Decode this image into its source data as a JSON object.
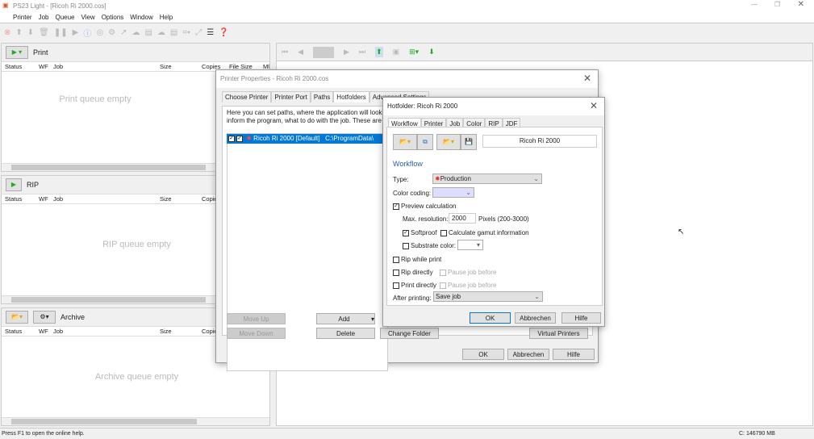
{
  "app": {
    "title": "PS23 Light - [Ricoh Ri 2000.cos]"
  },
  "menu": [
    "Printer",
    "Job",
    "Queue",
    "View",
    "Options",
    "Window",
    "Help"
  ],
  "print_panel": {
    "title": "Print",
    "empty": "Print queue empty"
  },
  "rip_panel": {
    "title": "RIP",
    "empty": "RIP queue empty"
  },
  "archive_panel": {
    "title": "Archive",
    "empty": "Archive queue empty"
  },
  "columns": [
    "Status",
    "WF",
    "Job",
    "Size",
    "Copies",
    "File Size",
    "Ml"
  ],
  "printer_props": {
    "title": "Printer Properties - Ricoh Ri 2000.cos",
    "tabs": [
      "Choose Printer",
      "Printer Port",
      "Paths",
      "Hotfolders",
      "Advanced Settings"
    ],
    "desc1": "Here you can set paths, where the application will look f",
    "desc2": "inform the program, what to do with the job. These are",
    "item_name": "Ricoh Ri 2000 [Default]",
    "item_path": "C:\\ProgramData\\",
    "move_up": "Move Up",
    "move_down": "Move Down",
    "add": "Add",
    "delete": "Delete",
    "change_folder": "Change Folder",
    "virtual_printers": "Virtual Printers",
    "ok": "OK",
    "cancel": "Abbrechen",
    "help": "Hilfe"
  },
  "hotfolder": {
    "title": "Hotfolder: Ricoh Ri 2000",
    "tabs": [
      "Workflow",
      "Printer",
      "Job",
      "Color",
      "RIP",
      "JDF"
    ],
    "name": "Ricoh Ri 2000",
    "section": "Workflow",
    "type_label": "Type:",
    "type_value": "Production",
    "color_coding_label": "Color coding:",
    "preview": "Preview calculation",
    "max_res_label": "Max. resolution:",
    "max_res_value": "2000",
    "pixels": "Pixels (200-3000)",
    "softproof": "Softproof",
    "gamut": "Calculate gamut information",
    "substrate": "Substrate color:",
    "rip_while_print": "Rip while print",
    "rip_directly": "Rip directly",
    "pause1": "Pause job before",
    "print_directly": "Print directly",
    "pause2": "Pause job before",
    "after_label": "After printing:",
    "after_value": "Save job",
    "ok": "OK",
    "cancel": "Abbrechen",
    "help": "Hilfe"
  },
  "statusbar": {
    "help": "Press F1 to open the online help.",
    "disk": "C: 146790 MB"
  }
}
